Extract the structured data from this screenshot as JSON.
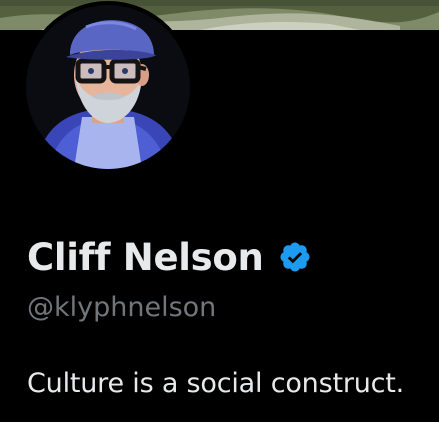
{
  "profile": {
    "display_name": "Cliff Nelson",
    "handle": "@klyphnelson",
    "bio": "Culture is a social construct.",
    "verified": true
  },
  "colors": {
    "background": "#000000",
    "primary_text": "#e7e9ea",
    "secondary_text": "#71767b",
    "verified_badge": "#1d9bf0"
  },
  "icons": {
    "verified": "verified-badge-icon"
  }
}
